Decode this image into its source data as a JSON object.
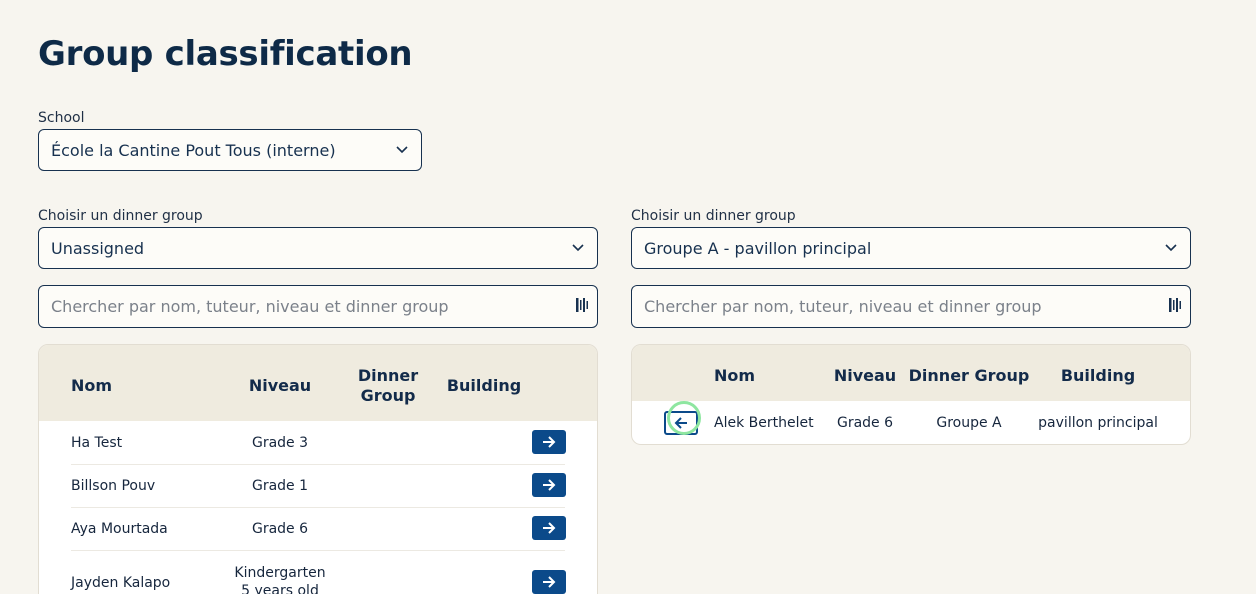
{
  "page": {
    "title": "Group classification"
  },
  "school": {
    "label": "School",
    "value": "École la Cantine Pout Tous (interne)"
  },
  "left": {
    "group_label": "Choisir un dinner group",
    "group_value": "Unassigned",
    "search_placeholder": "Chercher par nom, tuteur, niveau et dinner group",
    "headers": {
      "nom": "Nom",
      "niveau": "Niveau",
      "dinner_group": "Dinner Group",
      "building": "Building"
    },
    "rows": [
      {
        "nom": "Ha Test",
        "niveau": "Grade 3",
        "dinner_group": "",
        "building": ""
      },
      {
        "nom": "Billson Pouv",
        "niveau": "Grade 1",
        "dinner_group": "",
        "building": ""
      },
      {
        "nom": "Aya Mourtada",
        "niveau": "Grade 6",
        "dinner_group": "",
        "building": ""
      },
      {
        "nom": "Jayden Kalapo",
        "niveau": "Kindergarten 5 years old",
        "niveau_line1": "Kindergarten",
        "niveau_line2": "5 years old",
        "dinner_group": "",
        "building": ""
      }
    ]
  },
  "right": {
    "group_label": "Choisir un dinner group",
    "group_value": "Groupe A - pavillon principal",
    "search_placeholder": "Chercher par nom, tuteur, niveau et dinner group",
    "headers": {
      "nom": "Nom",
      "niveau": "Niveau",
      "dinner_group": "Dinner Group",
      "building": "Building"
    },
    "rows": [
      {
        "nom": "Alek Berthelet",
        "niveau": "Grade 6",
        "dinner_group": "Groupe A",
        "building": "pavillon principal"
      }
    ]
  },
  "colors": {
    "background": "#f7f5ef",
    "primary": "#0b4a8a",
    "text": "#13294b",
    "header_bg": "#efebdf",
    "focus": "#8ee6a0"
  },
  "icons": {
    "dropdown": "chevron-down-icon",
    "scan": "barcode-scan-icon",
    "move_right": "arrow-right-icon",
    "move_left": "arrow-left-icon"
  }
}
